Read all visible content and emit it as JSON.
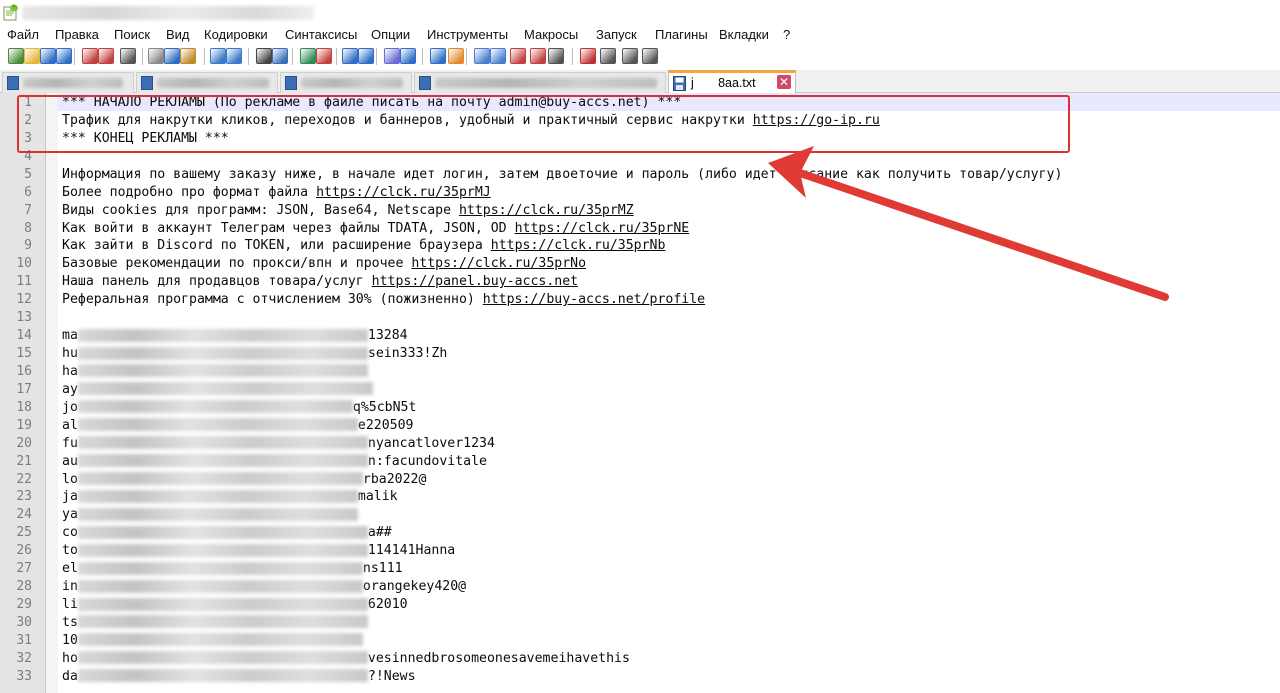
{
  "menu": [
    "Файл",
    "Правка",
    "Поиск",
    "Вид",
    "Кодировки",
    "Синтаксисы",
    "Опции",
    "Инструменты",
    "Макросы",
    "Запуск",
    "Плагины",
    "Вкладки",
    "?"
  ],
  "tabs": {
    "active_label": "j       8aa.txt",
    "close_glyph": "✕"
  },
  "icons": [
    "new-file-icon",
    "open-file-icon",
    "save-icon",
    "save-all-icon",
    "close-icon",
    "close-all-icon",
    "print-icon",
    "cut-icon",
    "copy-icon",
    "paste-icon",
    "undo-icon",
    "redo-icon",
    "find-icon",
    "replace-icon",
    "zoom-in-icon",
    "zoom-out-icon",
    "sync-v-icon",
    "sync-h-icon",
    "wrap-icon",
    "all-chars-icon",
    "indent-guide-icon",
    "udl-icon",
    "doc-map-icon",
    "func-list-icon",
    "folder-workspace-icon",
    "monitor-icon",
    "record-macro-icon",
    "stop-macro-icon",
    "play-macro-icon",
    "run-macro-icon",
    "save-macro-icon"
  ],
  "colors": {
    "highlight_box": "#dd3030",
    "arrow": "#e03a34",
    "gutter": "#e4e4e4",
    "tab_accent": "#f7a43a"
  },
  "line_numbers": [
    "1",
    "2",
    "3",
    "4",
    "5",
    "6",
    "7",
    "8",
    "9",
    "10",
    "11",
    "12",
    "13",
    "14",
    "15",
    "16",
    "17",
    "18",
    "19",
    "20",
    "21",
    "22",
    "23",
    "24",
    "25",
    "26",
    "27",
    "28",
    "29",
    "30",
    "31",
    "32",
    "33"
  ],
  "lines": [
    {
      "text": "*** НАЧАЛО РЕКЛАМЫ (По рекламе в файле писать на почту admin@buy-accs.net) ***",
      "url": ""
    },
    {
      "text": "Трафик для накрутки кликов, переходов и баннеров, удобный и практичный сервис накрутки ",
      "url": "https://go-ip.ru"
    },
    {
      "text": "*** КОНЕЦ РЕКЛАМЫ ***",
      "url": ""
    },
    {
      "text": "",
      "url": ""
    },
    {
      "text": "Информация по вашему заказу ниже, в начале идет логин, затем двоеточие и пароль (либо идет описание как получить товар/услугу)",
      "url": ""
    },
    {
      "text": "Более подробно про формат файла ",
      "url": "https://clck.ru/35prMJ"
    },
    {
      "text": "Виды cookies для программ: JSON, Base64, Netscape ",
      "url": "https://clck.ru/35prMZ"
    },
    {
      "text": "Как войти в аккаунт Телеграм через файлы TDATA, JSON, OD ",
      "url": "https://clck.ru/35prNE"
    },
    {
      "text": "Как зайти в Discord по TOKEN, или расширение браузера ",
      "url": "https://clck.ru/35prNb"
    },
    {
      "text": "Базовые рекомендации по прокси/впн и прочее ",
      "url": "https://clck.ru/35prNo"
    },
    {
      "text": "Наша панель для продавцов товара/услуг ",
      "url": "https://panel.buy-accs.net"
    },
    {
      "text": "Реферальная программа с отчислением 30% (пожизненно) ",
      "url": "https://buy-accs.net/profile"
    },
    {
      "text": "",
      "url": ""
    },
    {
      "pre": "ma",
      "post": "13284"
    },
    {
      "pre": "hu",
      "post": "sein333!Zh"
    },
    {
      "pre": "ha",
      "post": ""
    },
    {
      "pre": "ay",
      "post": ""
    },
    {
      "pre": "jo",
      "post": "q%5cbN5t"
    },
    {
      "pre": "al",
      "post": "e220509"
    },
    {
      "pre": "fu",
      "post": "nyancatlover1234"
    },
    {
      "pre": "au",
      "post": "n:facundovitale"
    },
    {
      "pre": "lo",
      "post": "rba2022@"
    },
    {
      "pre": "ja",
      "post": "malik"
    },
    {
      "pre": "ya",
      "post": ""
    },
    {
      "pre": "co",
      "post": "a##"
    },
    {
      "pre": "to",
      "post": "114141Hanna"
    },
    {
      "pre": "el",
      "post": "ns111"
    },
    {
      "pre": "in",
      "post": "orangekey420@"
    },
    {
      "pre": "li",
      "post": "62010"
    },
    {
      "pre": "ts",
      "post": ""
    },
    {
      "pre": "10",
      "post": ""
    },
    {
      "pre": "ho",
      "post": "vesinnedbrosomeonesavemeihavethis"
    },
    {
      "pre": "da",
      "post": "?!News"
    }
  ]
}
